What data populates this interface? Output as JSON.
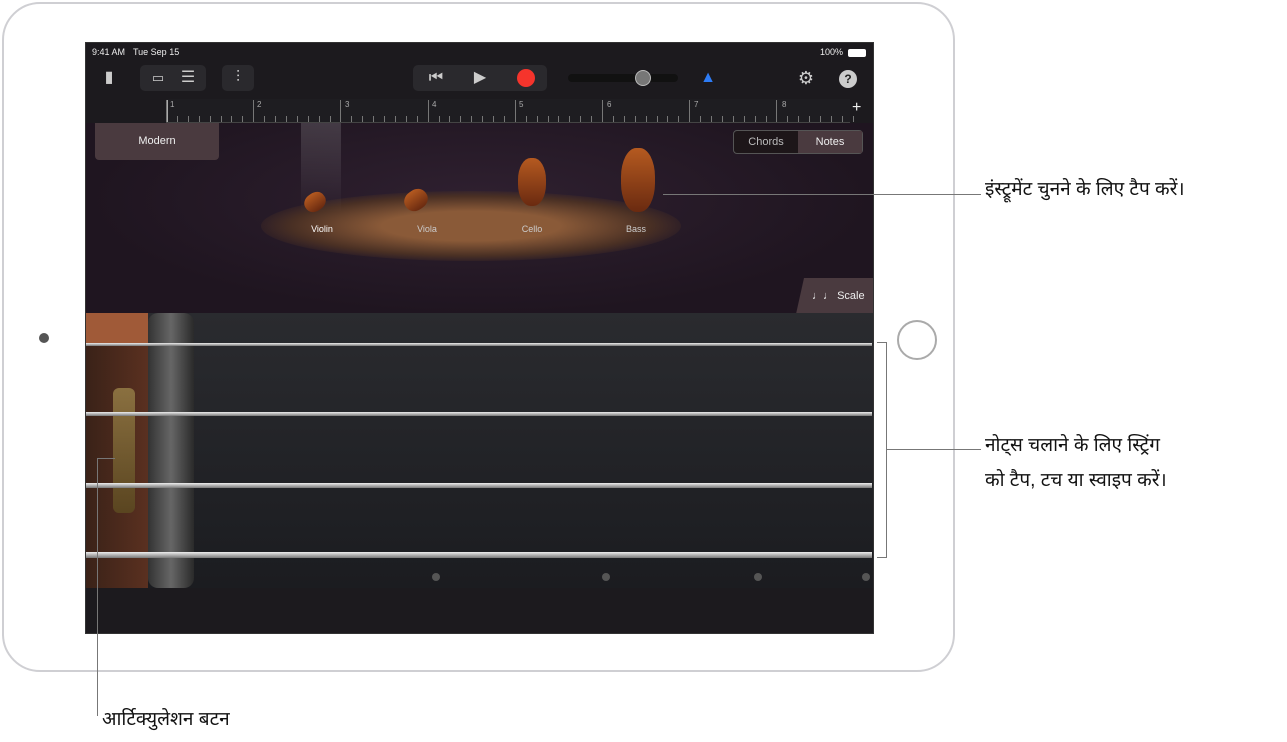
{
  "status": {
    "time": "9:41 AM",
    "date": "Tue Sep 15",
    "battery": "100%"
  },
  "toolbar": {
    "icons": [
      "document-icon",
      "track-view-icon",
      "list-view-icon",
      "mixer-icon",
      "rewind-icon",
      "play-icon",
      "record-icon",
      "volume-slider",
      "metronome-icon",
      "settings-icon",
      "help-icon"
    ],
    "help": "?",
    "add": "+",
    "record_color": "#f5342c",
    "metronome_color": "#2d7cf6"
  },
  "ruler": {
    "bars": [
      "1",
      "2",
      "3",
      "4",
      "5",
      "6",
      "7",
      "8"
    ]
  },
  "preset": "Modern",
  "mode": {
    "chords": "Chords",
    "notes": "Notes",
    "selected": "Notes"
  },
  "instruments": [
    {
      "label": "Violin",
      "selected": true
    },
    {
      "label": "Viola"
    },
    {
      "label": "Cello"
    },
    {
      "label": "Bass"
    }
  ],
  "scale_button": "Scale",
  "callouts": {
    "instrument": "इंस्ट्रूमेंट चुनने के लिए टैप करें।",
    "strings_line1": "नोट्स चलाने के लिए स्ट्रिंग",
    "strings_line2": "को टैप, टच या स्वाइप करें।",
    "articulation": "आर्टिक्युलेशन बटन"
  }
}
